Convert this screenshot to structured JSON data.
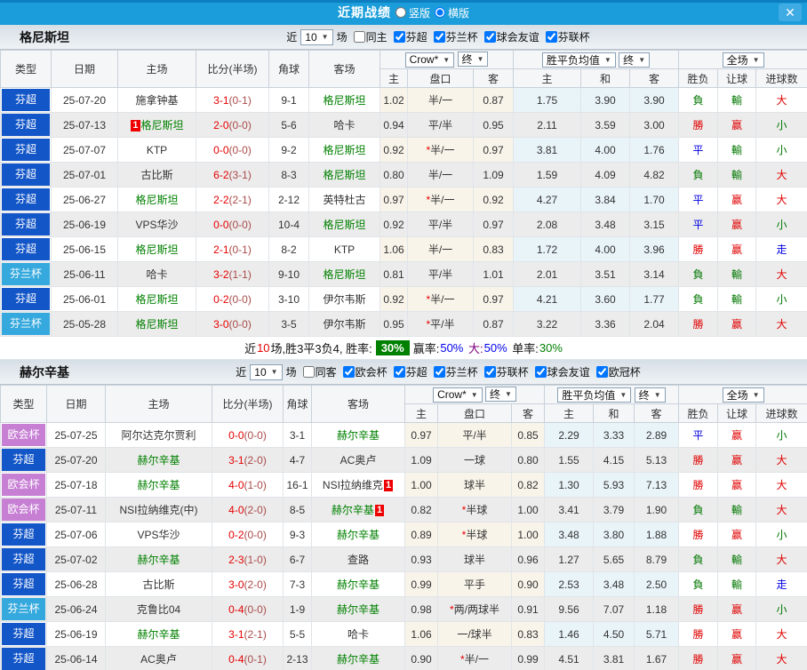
{
  "titlebar": {
    "title": "近期战绩",
    "radio_vertical": "竖版",
    "radio_horizontal": "横版",
    "selected": "横版",
    "close_icon": "✕"
  },
  "filter": {
    "near": "近",
    "match": "场"
  },
  "table_header": {
    "cols": [
      "类型",
      "日期",
      "主场",
      "比分(半场)",
      "角球",
      "客场"
    ],
    "odds_select": "Crow*",
    "odds_final": "终",
    "avg_select": "胜平负均值",
    "avg_final": "终",
    "scope_select": "全场",
    "sub": [
      "主",
      "盘口",
      "客",
      "主",
      "和",
      "客",
      "胜负",
      "让球",
      "进球数"
    ]
  },
  "colors": {
    "titlebar_blue": "#1a9dda",
    "league_blue": "#1356c8",
    "league_cyan": "#35a9dd",
    "league_purple": "#c77fd4",
    "self_team_green": "#008000",
    "score_red": "#e60000",
    "win_rate_badge_green": "#008000"
  },
  "sections": [
    {
      "team": "格尼斯坦",
      "near_count": "10",
      "same_label": "同主",
      "same_checked": false,
      "leagues": [
        "芬超",
        "芬兰杯",
        "球会友谊",
        "芬联杯"
      ],
      "rows": [
        {
          "league": "芬超",
          "lclass": "blue",
          "date": "25-07-20",
          "home": "施拿钟基",
          "home_self": false,
          "home_badge": "",
          "score": "3-1",
          "half": "(0-1)",
          "corner": "9-1",
          "away": "格尼斯坦",
          "away_self": true,
          "away_badge": "",
          "o1": "1.02",
          "star": false,
          "hcap": "半/一",
          "o2": "0.87",
          "a1": "1.75",
          "a2": "3.90",
          "a3": "3.90",
          "res": "負",
          "resc": "g",
          "hres": "輸",
          "hresc": "g",
          "goal": "大",
          "goalc": "r"
        },
        {
          "league": "芬超",
          "lclass": "blue",
          "date": "25-07-13",
          "home": "格尼斯坦",
          "home_self": true,
          "home_badge": "1",
          "score": "2-0",
          "half": "(0-0)",
          "corner": "5-6",
          "away": "哈卡",
          "away_self": false,
          "away_badge": "",
          "o1": "0.94",
          "star": false,
          "hcap": "平/半",
          "o2": "0.95",
          "a1": "2.11",
          "a2": "3.59",
          "a3": "3.00",
          "res": "勝",
          "resc": "r",
          "hres": "赢",
          "hresc": "r",
          "goal": "小",
          "goalc": "g"
        },
        {
          "league": "芬超",
          "lclass": "blue",
          "date": "25-07-07",
          "home": "KTP",
          "home_self": false,
          "home_badge": "",
          "score": "0-0",
          "half": "(0-0)",
          "corner": "9-2",
          "away": "格尼斯坦",
          "away_self": true,
          "away_badge": "",
          "o1": "0.92",
          "star": true,
          "hcap": "半/一",
          "o2": "0.97",
          "a1": "3.81",
          "a2": "4.00",
          "a3": "1.76",
          "res": "平",
          "resc": "b",
          "hres": "輸",
          "hresc": "g",
          "goal": "小",
          "goalc": "g"
        },
        {
          "league": "芬超",
          "lclass": "blue",
          "date": "25-07-01",
          "home": "古比斯",
          "home_self": false,
          "home_badge": "",
          "score": "6-2",
          "half": "(3-1)",
          "corner": "8-3",
          "away": "格尼斯坦",
          "away_self": true,
          "away_badge": "",
          "o1": "0.80",
          "star": false,
          "hcap": "半/一",
          "o2": "1.09",
          "a1": "1.59",
          "a2": "4.09",
          "a3": "4.82",
          "res": "負",
          "resc": "g",
          "hres": "輸",
          "hresc": "g",
          "goal": "大",
          "goalc": "r"
        },
        {
          "league": "芬超",
          "lclass": "blue",
          "date": "25-06-27",
          "home": "格尼斯坦",
          "home_self": true,
          "home_badge": "",
          "score": "2-2",
          "half": "(2-1)",
          "corner": "2-12",
          "away": "英特杜古",
          "away_self": false,
          "away_badge": "",
          "o1": "0.97",
          "star": true,
          "hcap": "半/一",
          "o2": "0.92",
          "a1": "4.27",
          "a2": "3.84",
          "a3": "1.70",
          "res": "平",
          "resc": "b",
          "hres": "赢",
          "hresc": "r",
          "goal": "大",
          "goalc": "r"
        },
        {
          "league": "芬超",
          "lclass": "blue",
          "date": "25-06-19",
          "home": "VPS华沙",
          "home_self": false,
          "home_badge": "",
          "score": "0-0",
          "half": "(0-0)",
          "corner": "10-4",
          "away": "格尼斯坦",
          "away_self": true,
          "away_badge": "",
          "o1": "0.92",
          "star": false,
          "hcap": "平/半",
          "o2": "0.97",
          "a1": "2.08",
          "a2": "3.48",
          "a3": "3.15",
          "res": "平",
          "resc": "b",
          "hres": "赢",
          "hresc": "r",
          "goal": "小",
          "goalc": "g"
        },
        {
          "league": "芬超",
          "lclass": "blue",
          "date": "25-06-15",
          "home": "格尼斯坦",
          "home_self": true,
          "home_badge": "",
          "score": "2-1",
          "half": "(0-1)",
          "corner": "8-2",
          "away": "KTP",
          "away_self": false,
          "away_badge": "",
          "o1": "1.06",
          "star": false,
          "hcap": "半/一",
          "o2": "0.83",
          "a1": "1.72",
          "a2": "4.00",
          "a3": "3.96",
          "res": "勝",
          "resc": "r",
          "hres": "赢",
          "hresc": "r",
          "goal": "走",
          "goalc": "b"
        },
        {
          "league": "芬兰杯",
          "lclass": "cyan",
          "date": "25-06-11",
          "home": "哈卡",
          "home_self": false,
          "home_badge": "",
          "score": "3-2",
          "half": "(1-1)",
          "corner": "9-10",
          "away": "格尼斯坦",
          "away_self": true,
          "away_badge": "",
          "o1": "0.81",
          "star": false,
          "hcap": "平/半",
          "o2": "1.01",
          "a1": "2.01",
          "a2": "3.51",
          "a3": "3.14",
          "res": "負",
          "resc": "g",
          "hres": "輸",
          "hresc": "g",
          "goal": "大",
          "goalc": "r"
        },
        {
          "league": "芬超",
          "lclass": "blue",
          "date": "25-06-01",
          "home": "格尼斯坦",
          "home_self": true,
          "home_badge": "",
          "score": "0-2",
          "half": "(0-0)",
          "corner": "3-10",
          "away": "伊尔韦斯",
          "away_self": false,
          "away_badge": "",
          "o1": "0.92",
          "star": true,
          "hcap": "半/一",
          "o2": "0.97",
          "a1": "4.21",
          "a2": "3.60",
          "a3": "1.77",
          "res": "負",
          "resc": "g",
          "hres": "輸",
          "hresc": "g",
          "goal": "小",
          "goalc": "g"
        },
        {
          "league": "芬兰杯",
          "lclass": "cyan",
          "date": "25-05-28",
          "home": "格尼斯坦",
          "home_self": true,
          "home_badge": "",
          "score": "3-0",
          "half": "(0-0)",
          "corner": "3-5",
          "away": "伊尔韦斯",
          "away_self": false,
          "away_badge": "",
          "o1": "0.95",
          "star": true,
          "hcap": "平/半",
          "o2": "0.87",
          "a1": "3.22",
          "a2": "3.36",
          "a3": "2.04",
          "res": "勝",
          "resc": "r",
          "hres": "赢",
          "hresc": "r",
          "goal": "大",
          "goalc": "r"
        }
      ],
      "summary": {
        "text_prefix": "近",
        "count": "10",
        "text_mid": "场,胜3平3负4, 胜率:",
        "win_rate": "30%",
        "label_win": "赢率:",
        "val_win": "50%",
        "label_big": "大:",
        "val_big": "50%",
        "label_single": "单率:",
        "val_single": "30%"
      }
    },
    {
      "team": "赫尔辛基",
      "near_count": "10",
      "same_label": "同客",
      "same_checked": false,
      "leagues": [
        "欧会杯",
        "芬超",
        "芬兰杯",
        "芬联杯",
        "球会友谊",
        "欧冠杯"
      ],
      "rows": [
        {
          "league": "欧会杯",
          "lclass": "purple",
          "date": "25-07-25",
          "home": "阿尔达克尔贾利",
          "home_self": false,
          "home_badge": "",
          "score": "0-0",
          "half": "(0-0)",
          "corner": "3-1",
          "away": "赫尔辛基",
          "away_self": true,
          "away_badge": "",
          "o1": "0.97",
          "star": false,
          "hcap": "平/半",
          "o2": "0.85",
          "a1": "2.29",
          "a2": "3.33",
          "a3": "2.89",
          "res": "平",
          "resc": "b",
          "hres": "赢",
          "hresc": "r",
          "goal": "小",
          "goalc": "g"
        },
        {
          "league": "芬超",
          "lclass": "blue",
          "date": "25-07-20",
          "home": "赫尔辛基",
          "home_self": true,
          "home_badge": "",
          "score": "3-1",
          "half": "(2-0)",
          "corner": "4-7",
          "away": "AC奥卢",
          "away_self": false,
          "away_badge": "",
          "o1": "1.09",
          "star": false,
          "hcap": "一球",
          "o2": "0.80",
          "a1": "1.55",
          "a2": "4.15",
          "a3": "5.13",
          "res": "勝",
          "resc": "r",
          "hres": "赢",
          "hresc": "r",
          "goal": "大",
          "goalc": "r"
        },
        {
          "league": "欧会杯",
          "lclass": "purple",
          "date": "25-07-18",
          "home": "赫尔辛基",
          "home_self": true,
          "home_badge": "",
          "score": "4-0",
          "half": "(1-0)",
          "corner": "16-1",
          "away": "NSI拉纳维克",
          "away_self": false,
          "away_badge": "1",
          "o1": "1.00",
          "star": false,
          "hcap": "球半",
          "o2": "0.82",
          "a1": "1.30",
          "a2": "5.93",
          "a3": "7.13",
          "res": "勝",
          "resc": "r",
          "hres": "赢",
          "hresc": "r",
          "goal": "大",
          "goalc": "r"
        },
        {
          "league": "欧会杯",
          "lclass": "purple",
          "date": "25-07-11",
          "home": "NSI拉纳维克(中)",
          "home_self": false,
          "home_badge": "",
          "score": "4-0",
          "half": "(2-0)",
          "corner": "8-5",
          "away": "赫尔辛基",
          "away_self": true,
          "away_badge": "1",
          "o1": "0.82",
          "star": true,
          "hcap": "半球",
          "o2": "1.00",
          "a1": "3.41",
          "a2": "3.79",
          "a3": "1.90",
          "res": "負",
          "resc": "g",
          "hres": "輸",
          "hresc": "g",
          "goal": "大",
          "goalc": "r"
        },
        {
          "league": "芬超",
          "lclass": "blue",
          "date": "25-07-06",
          "home": "VPS华沙",
          "home_self": false,
          "home_badge": "",
          "score": "0-2",
          "half": "(0-0)",
          "corner": "9-3",
          "away": "赫尔辛基",
          "away_self": true,
          "away_badge": "",
          "o1": "0.89",
          "star": true,
          "hcap": "半球",
          "o2": "1.00",
          "a1": "3.48",
          "a2": "3.80",
          "a3": "1.88",
          "res": "勝",
          "resc": "r",
          "hres": "赢",
          "hresc": "r",
          "goal": "小",
          "goalc": "g"
        },
        {
          "league": "芬超",
          "lclass": "blue",
          "date": "25-07-02",
          "home": "赫尔辛基",
          "home_self": true,
          "home_badge": "",
          "score": "2-3",
          "half": "(1-0)",
          "corner": "6-7",
          "away": "查路",
          "away_self": false,
          "away_badge": "",
          "o1": "0.93",
          "star": false,
          "hcap": "球半",
          "o2": "0.96",
          "a1": "1.27",
          "a2": "5.65",
          "a3": "8.79",
          "res": "負",
          "resc": "g",
          "hres": "輸",
          "hresc": "g",
          "goal": "大",
          "goalc": "r"
        },
        {
          "league": "芬超",
          "lclass": "blue",
          "date": "25-06-28",
          "home": "古比斯",
          "home_self": false,
          "home_badge": "",
          "score": "3-0",
          "half": "(2-0)",
          "corner": "7-3",
          "away": "赫尔辛基",
          "away_self": true,
          "away_badge": "",
          "o1": "0.99",
          "star": false,
          "hcap": "平手",
          "o2": "0.90",
          "a1": "2.53",
          "a2": "3.48",
          "a3": "2.50",
          "res": "負",
          "resc": "g",
          "hres": "輸",
          "hresc": "g",
          "goal": "走",
          "goalc": "b"
        },
        {
          "league": "芬兰杯",
          "lclass": "cyan",
          "date": "25-06-24",
          "home": "克鲁比04",
          "home_self": false,
          "home_badge": "",
          "score": "0-4",
          "half": "(0-0)",
          "corner": "1-9",
          "away": "赫尔辛基",
          "away_self": true,
          "away_badge": "",
          "o1": "0.98",
          "star": true,
          "hcap": "两/两球半",
          "o2": "0.91",
          "a1": "9.56",
          "a2": "7.07",
          "a3": "1.18",
          "res": "勝",
          "resc": "r",
          "hres": "赢",
          "hresc": "r",
          "goal": "小",
          "goalc": "g"
        },
        {
          "league": "芬超",
          "lclass": "blue",
          "date": "25-06-19",
          "home": "赫尔辛基",
          "home_self": true,
          "home_badge": "",
          "score": "3-1",
          "half": "(2-1)",
          "corner": "5-5",
          "away": "哈卡",
          "away_self": false,
          "away_badge": "",
          "o1": "1.06",
          "star": false,
          "hcap": "一/球半",
          "o2": "0.83",
          "a1": "1.46",
          "a2": "4.50",
          "a3": "5.71",
          "res": "勝",
          "resc": "r",
          "hres": "赢",
          "hresc": "r",
          "goal": "大",
          "goalc": "r"
        },
        {
          "league": "芬超",
          "lclass": "blue",
          "date": "25-06-14",
          "home": "AC奥卢",
          "home_self": false,
          "home_badge": "",
          "score": "0-4",
          "half": "(0-1)",
          "corner": "2-13",
          "away": "赫尔辛基",
          "away_self": true,
          "away_badge": "",
          "o1": "0.90",
          "star": true,
          "hcap": "半/一",
          "o2": "0.99",
          "a1": "4.51",
          "a2": "3.81",
          "a3": "1.67",
          "res": "勝",
          "resc": "r",
          "hres": "赢",
          "hresc": "r",
          "goal": "大",
          "goalc": "r"
        }
      ]
    }
  ]
}
